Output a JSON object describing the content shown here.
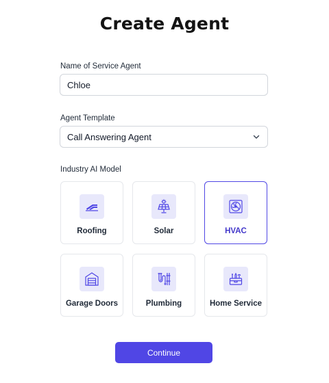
{
  "page": {
    "title": "Create Agent"
  },
  "agent_name": {
    "label": "Name of Service Agent",
    "value": "Chloe"
  },
  "template": {
    "label": "Agent Template",
    "selected": "Call Answering Agent"
  },
  "industry": {
    "label": "Industry AI Model",
    "selected": "HVAC",
    "options": [
      {
        "label": "Roofing",
        "icon": "roof-icon"
      },
      {
        "label": "Solar",
        "icon": "solar-panel-icon"
      },
      {
        "label": "HVAC",
        "icon": "fan-icon"
      },
      {
        "label": "Garage Doors",
        "icon": "garage-door-icon"
      },
      {
        "label": "Plumbing",
        "icon": "pipes-icon"
      },
      {
        "label": "Home Service",
        "icon": "toolbox-icon"
      }
    ]
  },
  "actions": {
    "continue_label": "Continue"
  },
  "colors": {
    "accent": "#5046e5",
    "icon_bg": "#e8e8fb",
    "border": "#e5e7eb"
  }
}
